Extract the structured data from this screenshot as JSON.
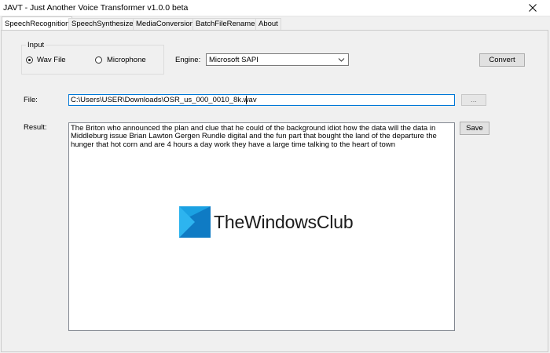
{
  "window": {
    "title": "JAVT - Just Another Voice Transformer v1.0.0 beta",
    "close_icon": "close-icon"
  },
  "tabs": [
    {
      "label": "SpeechRecognition",
      "active": true
    },
    {
      "label": "SpeechSynthesizer",
      "active": false
    },
    {
      "label": "MediaConversion",
      "active": false
    },
    {
      "label": "BatchFileRenamer",
      "active": false
    },
    {
      "label": "About",
      "active": false
    }
  ],
  "input_group": {
    "legend": "Input",
    "options": [
      {
        "label": "Wav File",
        "checked": true
      },
      {
        "label": "Microphone",
        "checked": false
      }
    ]
  },
  "engine": {
    "label": "Engine:",
    "value": "Microsoft SAPI"
  },
  "convert_label": "Convert",
  "file": {
    "label": "File:",
    "value": "C:\\Users\\USER\\Downloads\\OSR_us_000_0010_8k.wav",
    "browse_label": "..."
  },
  "result": {
    "label": "Result:",
    "text": " The Briton who announced the plan and clue that he could of the background idiot how the data will the data in Middleburg issue Brian Lawton Gergen Rundle digital and the fun part that bought the land of the departure the hunger that hot corn and are 4 hours a day work they have a large time talking to the heart of town",
    "save_label": "Save"
  },
  "watermark": {
    "text": "TheWindowsClub",
    "colors": [
      "#1ba1e2",
      "#0f7bc4"
    ]
  },
  "colors": {
    "focus_border": "#0078d7",
    "button_face": "#e1e1e1",
    "window_bg": "#f0f0f0"
  }
}
